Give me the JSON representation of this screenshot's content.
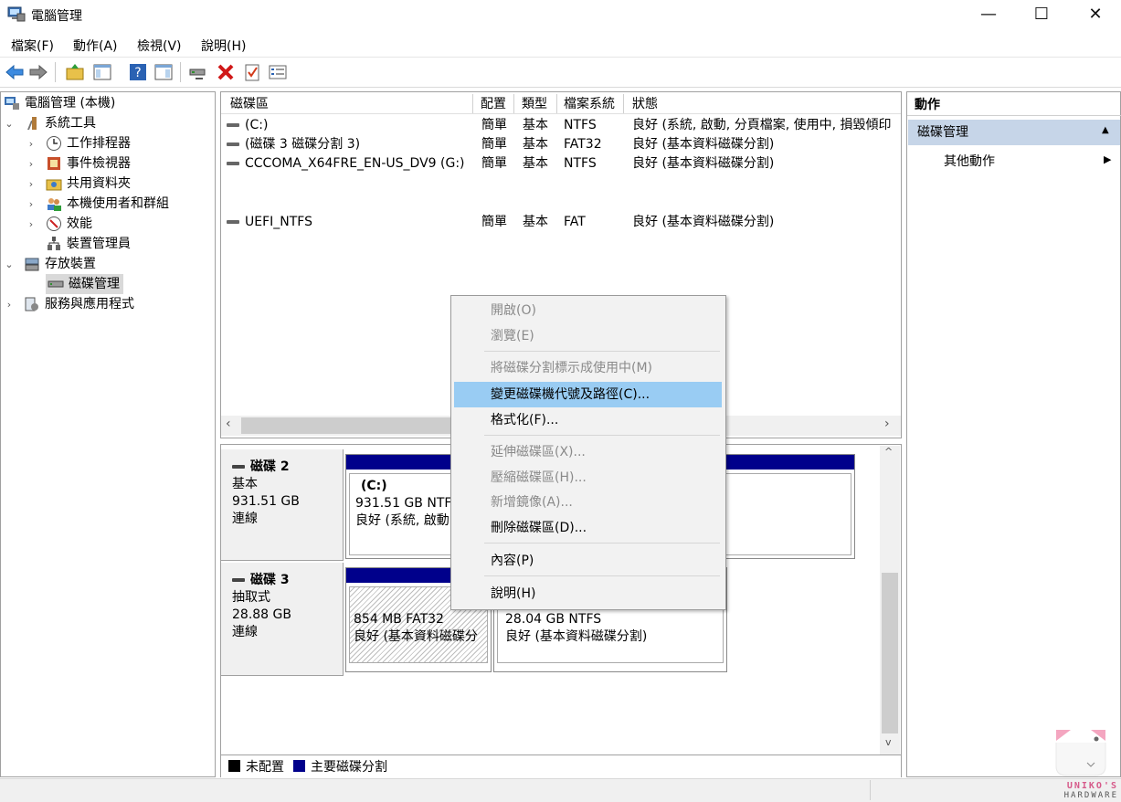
{
  "window": {
    "title": "電腦管理",
    "minimize_icon": "minimize-icon",
    "maximize_icon": "maximize-icon",
    "close_icon": "close-icon"
  },
  "menu": [
    "檔案(F)",
    "動作(A)",
    "檢視(V)",
    "說明(H)"
  ],
  "toolbar": [
    "back-icon",
    "forward-icon",
    "up-folder-icon",
    "show-hide-tree-icon",
    "help-icon",
    "show-hide-action-pane-icon",
    "connect-drive-icon",
    "delete-icon",
    "properties-icon",
    "settings-list-icon"
  ],
  "tree": [
    {
      "label": "電腦管理 (本機)",
      "level": 0,
      "expand": "",
      "icon": "computer-management-icon"
    },
    {
      "label": "系統工具",
      "level": 1,
      "expand": "⌄",
      "icon": "system-tools-icon"
    },
    {
      "label": "工作排程器",
      "level": 2,
      "expand": "›",
      "icon": "clock-icon"
    },
    {
      "label": "事件檢視器",
      "level": 2,
      "expand": "›",
      "icon": "event-viewer-icon"
    },
    {
      "label": "共用資料夾",
      "level": 2,
      "expand": "›",
      "icon": "shared-folder-icon"
    },
    {
      "label": "本機使用者和群組",
      "level": 2,
      "expand": "›",
      "icon": "users-icon"
    },
    {
      "label": "效能",
      "level": 2,
      "expand": "›",
      "icon": "performance-icon"
    },
    {
      "label": "裝置管理員",
      "level": 2,
      "expand": "",
      "icon": "device-manager-icon"
    },
    {
      "label": "存放裝置",
      "level": 1,
      "expand": "⌄",
      "icon": "storage-icon"
    },
    {
      "label": "磁碟管理",
      "level": 2,
      "expand": "",
      "icon": "disk-management-icon",
      "selected": true
    },
    {
      "label": "服務與應用程式",
      "level": 1,
      "expand": "›",
      "icon": "services-icon"
    }
  ],
  "columns": [
    "磁碟區",
    "配置",
    "類型",
    "檔案系統",
    "狀態"
  ],
  "volumes": [
    {
      "name": "(C:)",
      "layout": "簡單",
      "type": "基本",
      "fs": "NTFS",
      "status": "良好 (系統, 啟動, 分頁檔案, 使用中, 損毀傾印"
    },
    {
      "name": "(磁碟 3 磁碟分割 3)",
      "layout": "簡單",
      "type": "基本",
      "fs": "FAT32",
      "status": "良好 (基本資料磁碟分割)"
    },
    {
      "name": "CCCOMA_X64FRE_EN-US_DV9 (G:)",
      "layout": "簡單",
      "type": "基本",
      "fs": "NTFS",
      "status": "良好 (基本資料磁碟分割)"
    },
    {
      "name": "UEFI_NTFS",
      "layout": "簡單",
      "type": "基本",
      "fs": "FAT",
      "status": "良好 (基本資料磁碟分割)"
    }
  ],
  "disks": {
    "disk2": {
      "name": "磁碟 2",
      "type": "基本",
      "size": "931.51 GB",
      "state": "連線",
      "part": {
        "title": "(C:)",
        "size": "931.51 GB NTFS",
        "status": "良好 (系統, 啟動"
      }
    },
    "disk3": {
      "name": "磁碟 3",
      "type": "抽取式",
      "size": "28.88 GB",
      "state": "連線",
      "p1": {
        "size": "854 MB FAT32",
        "status": "良好 (基本資料磁碟分"
      },
      "p2": {
        "size": "28.04 GB NTFS",
        "status": "良好 (基本資料磁碟分割)"
      }
    }
  },
  "legend": {
    "unallocated": "未配置",
    "primary": "主要磁碟分割",
    "unallocated_color": "#000000",
    "primary_color": "#00008b"
  },
  "actions": {
    "header": "動作",
    "section": "磁碟管理",
    "more": "其他動作"
  },
  "context_menu": [
    {
      "label": "開啟(O)",
      "state": "disabled"
    },
    {
      "label": "瀏覽(E)",
      "state": "disabled"
    },
    {
      "label": "將磁碟分割標示成使用中(M)",
      "state": "disabled"
    },
    {
      "label": "變更磁碟機代號及路徑(C)...",
      "state": "highlighted"
    },
    {
      "label": "格式化(F)...",
      "state": "enabled"
    },
    {
      "label": "延伸磁碟區(X)...",
      "state": "disabled"
    },
    {
      "label": "壓縮磁碟區(H)...",
      "state": "disabled"
    },
    {
      "label": "新增鏡像(A)...",
      "state": "disabled"
    },
    {
      "label": "刪除磁碟區(D)...",
      "state": "enabled"
    },
    {
      "label": "內容(P)",
      "state": "enabled"
    },
    {
      "label": "說明(H)",
      "state": "enabled"
    }
  ],
  "watermark": {
    "brand": "UNIKO'S",
    "sub": "HARDWARE"
  }
}
